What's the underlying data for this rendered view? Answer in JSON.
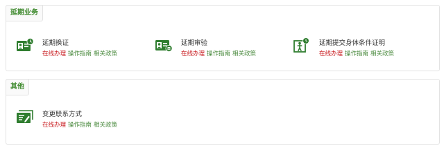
{
  "sections": [
    {
      "title": "延期业务",
      "items": [
        {
          "icon": "id-card-clock-icon",
          "title": "延期换证",
          "links": [
            "在线办理",
            "操作指南",
            "相关政策"
          ]
        },
        {
          "icon": "id-card-review-icon",
          "title": "延期审验",
          "links": [
            "在线办理",
            "操作指南",
            "相关政策"
          ]
        },
        {
          "icon": "person-clock-icon",
          "title": "延期提交身体条件证明",
          "links": [
            "在线办理",
            "操作指南",
            "相关政策"
          ]
        }
      ]
    },
    {
      "title": "其他",
      "items": [
        {
          "icon": "contact-card-edit-icon",
          "title": "变更联系方式",
          "links": [
            "在线办理",
            "操作指南",
            "相关政策"
          ]
        }
      ]
    }
  ],
  "colors": {
    "accent_green": "#3f8a2e",
    "icon_green": "#2f7d2f",
    "link_red": "#c8191d",
    "link_green": "#4a8a3e"
  }
}
